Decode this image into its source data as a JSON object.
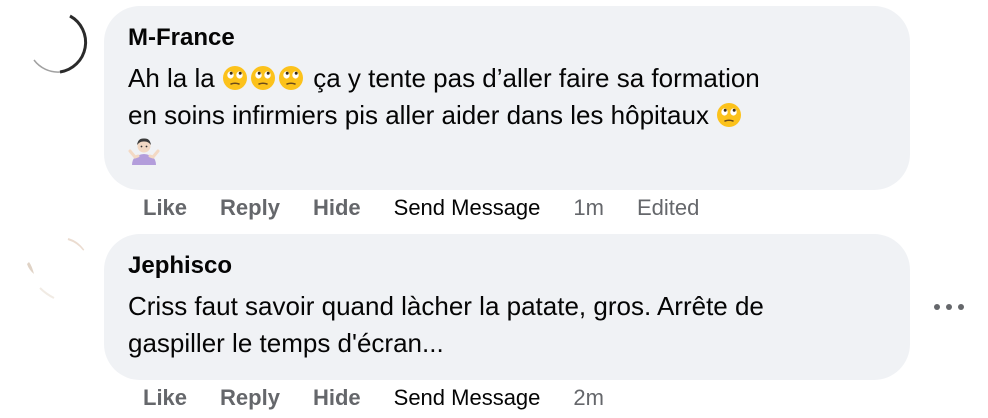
{
  "comments": [
    {
      "author": "M-France",
      "line1_prefix": "Ah la la",
      "line1_suffix": "ça y tente pas d’aller faire sa formation",
      "line2": "en soins infirmiers pis aller aider dans les hôpitaux",
      "emoji_names": [
        "face-with-rolling-eyes",
        "face-with-rolling-eyes",
        "face-with-rolling-eyes",
        "face-with-rolling-eyes",
        "person-shrugging"
      ],
      "actions": {
        "like": "Like",
        "reply": "Reply",
        "hide": "Hide",
        "send_message": "Send Message",
        "time": "1m",
        "edited": "Edited"
      }
    },
    {
      "author": "Jephisco",
      "line1": "Criss faut savoir quand làcher la patate, gros. Arrête de",
      "line2": "gaspiller le temps d'écran...",
      "actions": {
        "like": "Like",
        "reply": "Reply",
        "hide": "Hide",
        "send_message": "Send Message",
        "time": "2m"
      }
    }
  ],
  "more_menu_icon": "ellipsis-horizontal-icon",
  "colors": {
    "bubble": "#f0f2f5",
    "text_primary": "#050505",
    "text_secondary": "#65676b",
    "emoji_yellow": "#fcc21b",
    "shrug_purple": "#b39ddb"
  }
}
